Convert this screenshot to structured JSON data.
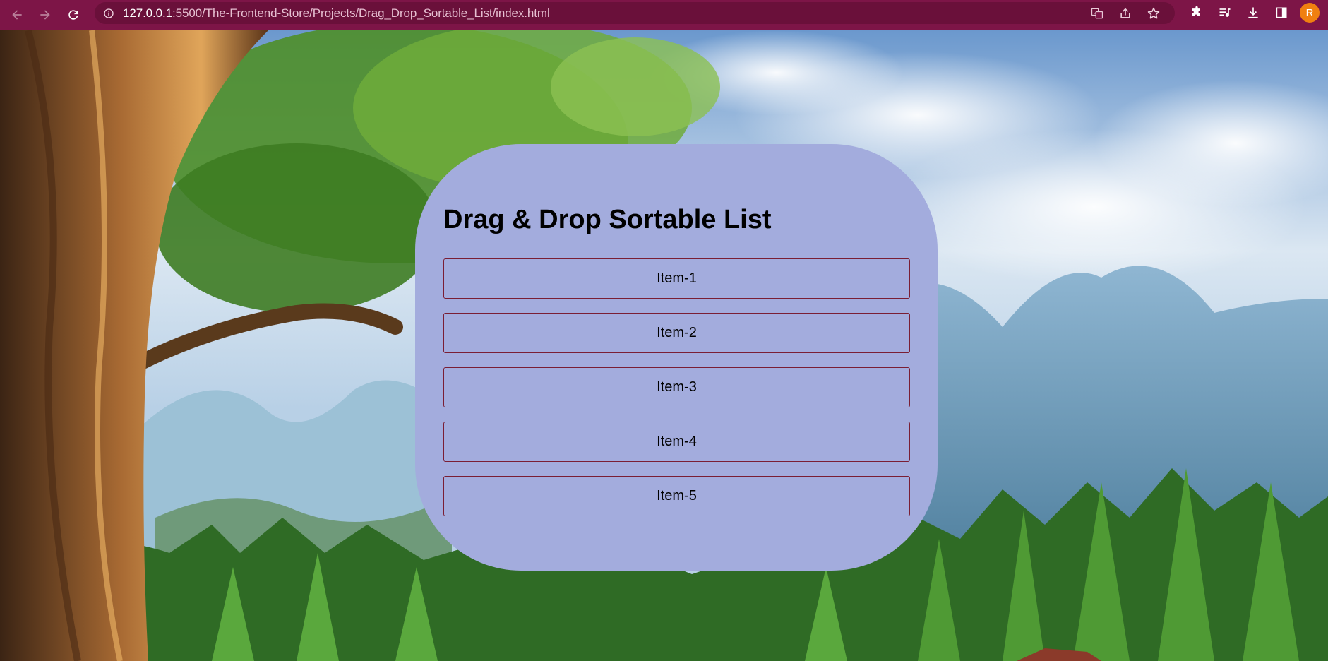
{
  "browser": {
    "url_host": "127.0.0.1",
    "url_path": ":5500/The-Frontend-Store/Projects/Drag_Drop_Sortable_List/index.html",
    "avatar_letter": "R",
    "toolbar_color": "#7d1547",
    "icons": [
      "back-icon",
      "forward-icon",
      "reload-icon",
      "info-icon",
      "translate-icon",
      "share-icon",
      "star-icon",
      "extensions-icon",
      "media-icon",
      "download-icon",
      "sidebar-icon"
    ]
  },
  "page": {
    "title": "Drag & Drop Sortable List",
    "card_color": "#a3acdd",
    "item_border_color": "#7a1e34",
    "items": [
      {
        "label": "Item-1"
      },
      {
        "label": "Item-2"
      },
      {
        "label": "Item-3"
      },
      {
        "label": "Item-4"
      },
      {
        "label": "Item-5"
      }
    ]
  }
}
